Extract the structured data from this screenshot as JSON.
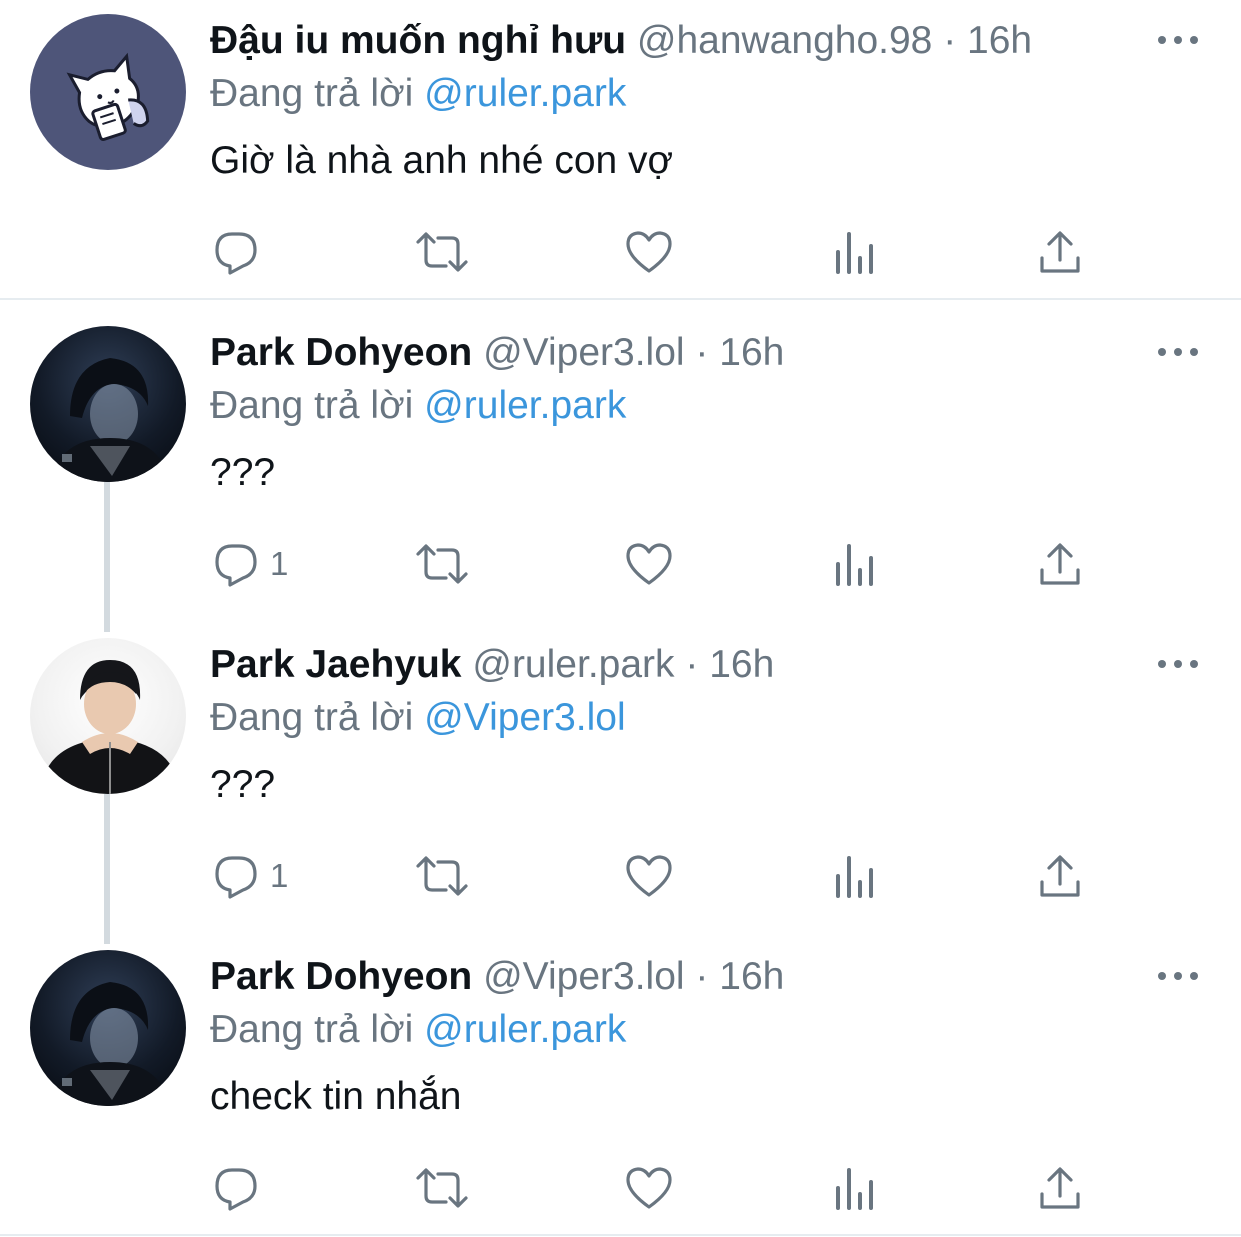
{
  "tweets": [
    {
      "name": "Đậu iu muốn nghỉ hưu",
      "handle": "@hanwangho.98",
      "dot": "·",
      "time": "16h",
      "reply_label": "Đang trả lời",
      "reply_user": "@ruler.park",
      "text": "Giờ là nhà anh nhé con vợ",
      "reply_count": "",
      "avatar": "cat-illustration-avatar"
    },
    {
      "name": "Park Dohyeon",
      "handle": "@Viper3.lol",
      "dot": "·",
      "time": "16h",
      "reply_label": "Đang trả lời",
      "reply_user": "@ruler.park",
      "text": "???",
      "reply_count": "1",
      "avatar": "dark-portrait-avatar"
    },
    {
      "name": "Park Jaehyuk",
      "handle": "@ruler.park",
      "dot": "·",
      "time": "16h",
      "reply_label": "Đang trả lời",
      "reply_user": "@Viper3.lol",
      "text": "???",
      "reply_count": "1",
      "avatar": "light-portrait-avatar"
    },
    {
      "name": "Park Dohyeon",
      "handle": "@Viper3.lol",
      "dot": "·",
      "time": "16h",
      "reply_label": "Đang trả lời",
      "reply_user": "@ruler.park",
      "text": "check tin nhắn",
      "reply_count": "",
      "avatar": "dark-portrait-avatar"
    }
  ],
  "icons": {
    "reply": "reply-icon",
    "retweet": "retweet-icon",
    "like": "heart-icon",
    "views": "views-icon",
    "share": "share-icon",
    "more": "more-icon"
  },
  "colors": {
    "name": "#0f1419",
    "secondary": "#697580",
    "link": "#3b96dc",
    "divider": "#e6ecf0",
    "thread_line": "#d3dadf"
  }
}
